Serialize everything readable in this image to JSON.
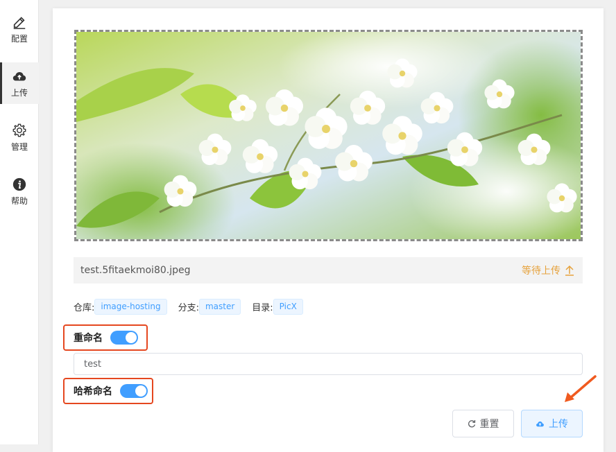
{
  "sidebar": {
    "items": [
      {
        "label": "配置",
        "icon": "pencil-icon"
      },
      {
        "label": "上传",
        "icon": "cloud-upload-icon",
        "active": true
      },
      {
        "label": "管理",
        "icon": "gear-icon"
      },
      {
        "label": "帮助",
        "icon": "info-icon"
      }
    ]
  },
  "file": {
    "name": "test.5fitaekmoi80.jpeg",
    "status": "等待上传"
  },
  "meta": {
    "repo_label": "仓库:",
    "repo_value": "image-hosting",
    "branch_label": "分支:",
    "branch_value": "master",
    "dir_label": "目录:",
    "dir_value": "PicX"
  },
  "rename": {
    "label": "重命名",
    "enabled": true,
    "value": "test"
  },
  "hash_rename": {
    "label": "哈希命名",
    "enabled": true
  },
  "buttons": {
    "reset_label": "重置",
    "upload_label": "上传"
  },
  "colors": {
    "accent": "#409eff",
    "warning": "#e6a23c",
    "highlight": "#e5471f"
  }
}
